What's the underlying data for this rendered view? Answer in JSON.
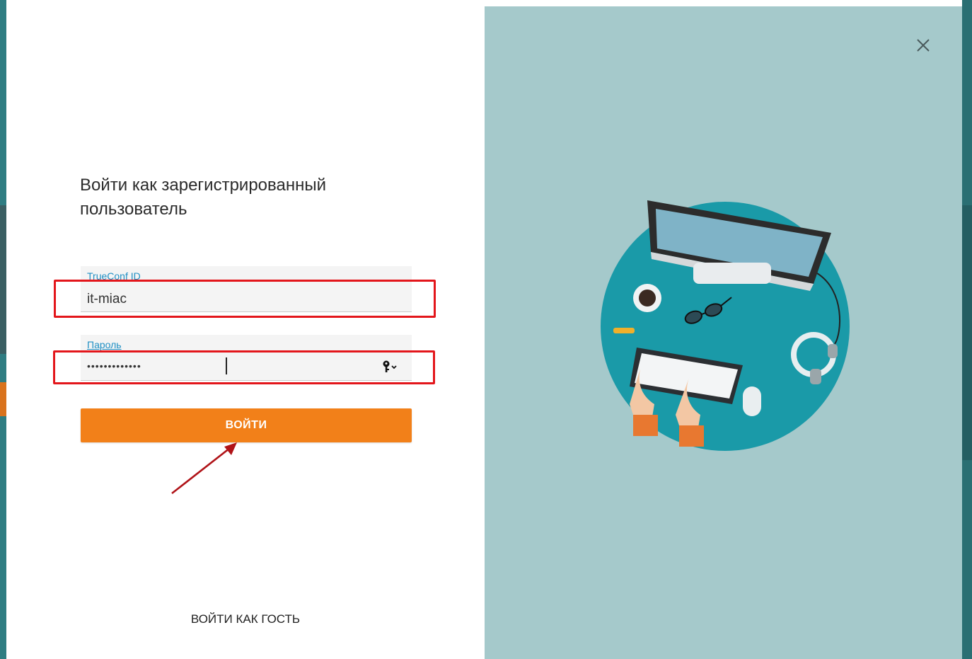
{
  "login": {
    "title": "Войти как зарегистрированный пользователь",
    "id_field": {
      "label": "TrueConf ID",
      "value": "it-miac"
    },
    "password_field": {
      "label": "Пароль",
      "value": "•••••••••••••"
    },
    "login_button": "ВОЙТИ",
    "guest_link": "ВОЙТИ КАК ГОСТЬ"
  },
  "colors": {
    "accent_orange": "#f28019",
    "label_blue": "#1f8fc4",
    "highlight_red": "#e3161b",
    "panel_teal": "#a5c9cb",
    "circle_teal": "#1a9aa8"
  },
  "icons": [
    "key-icon",
    "chevron-down-icon",
    "close-icon",
    "arrow-annotation"
  ]
}
